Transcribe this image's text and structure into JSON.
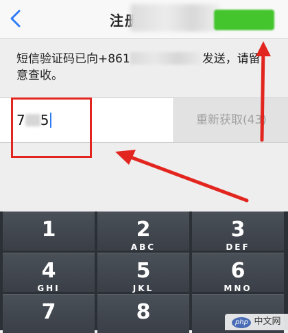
{
  "header": {
    "back_icon": "chevron-left-icon",
    "title": "注册",
    "next_button_color": "#44c52e"
  },
  "notice": {
    "prefix": "短信验证码已向+861",
    "suffix": "发送，请留意查收。"
  },
  "code_input": {
    "value": "7",
    "value_tail": "5"
  },
  "resend_button": {
    "label": "重新获取(43)"
  },
  "annotation_color": "#e2261f",
  "keypad": {
    "keys": [
      {
        "num": "1",
        "letters": ""
      },
      {
        "num": "2",
        "letters": "ABC"
      },
      {
        "num": "3",
        "letters": "DEF"
      },
      {
        "num": "4",
        "letters": "GHI"
      },
      {
        "num": "5",
        "letters": "JKL"
      },
      {
        "num": "6",
        "letters": "MNO"
      },
      {
        "num": "7",
        "letters": ""
      },
      {
        "num": "8",
        "letters": ""
      }
    ]
  },
  "watermark": {
    "logo": "php",
    "text": "中文网"
  }
}
